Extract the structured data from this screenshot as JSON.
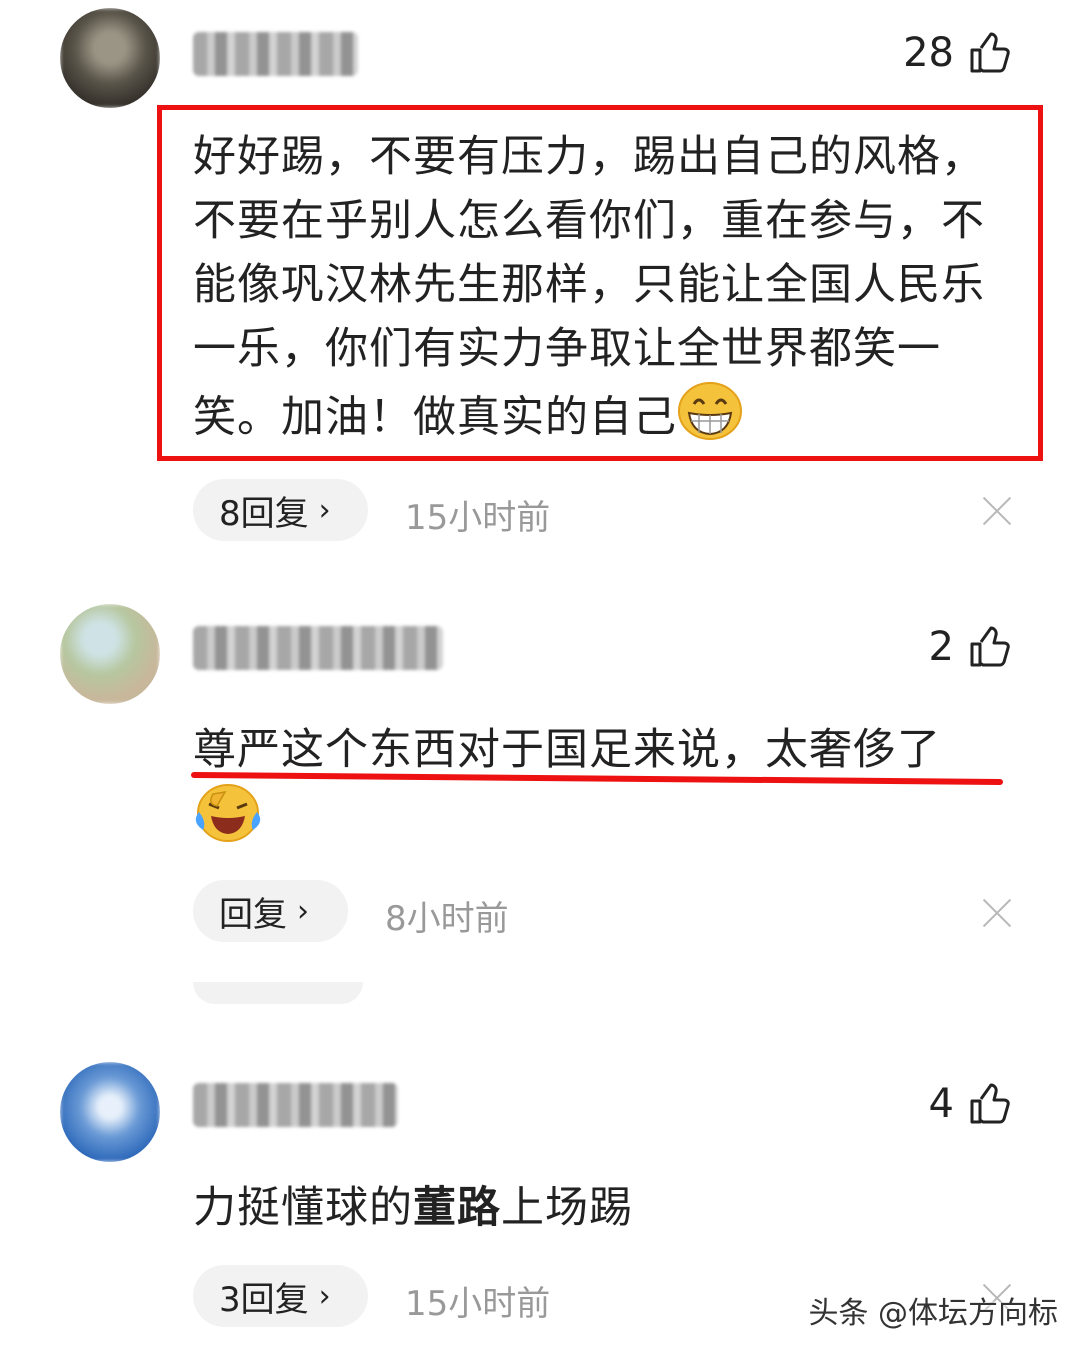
{
  "comments": [
    {
      "likes": "28",
      "text": "好好踢，不要有压力，踢出自己的风格，不要在乎别人怎么看你们，重在参与，不能像巩汉林先生那样，只能让全国人民乐一乐，你们有实力争取让全世界都笑一笑。加油！做真实的自己",
      "emoji": "grinning-face-emoji",
      "reply_label": "8回复",
      "time": "15小时前"
    },
    {
      "likes": "2",
      "text": "尊严这个东西对于国足来说，太奢侈了",
      "emoji": "laughing-crying-face-emoji",
      "reply_label": "回复",
      "time": "8小时前"
    },
    {
      "likes": "4",
      "text_before": "力挺懂球的",
      "text_bold": "董路",
      "text_after": "上场踢",
      "reply_label": "3回复",
      "time": "15小时前"
    }
  ],
  "watermark": "头条 @体坛方向标",
  "colors": {
    "highlight_red": "#ee1111",
    "muted_text": "#999999",
    "pill_bg": "#f2f2f2"
  },
  "icons": {
    "like": "thumbs-up-icon",
    "reply_arrow": "chevron-right-icon",
    "dismiss": "close-icon"
  }
}
